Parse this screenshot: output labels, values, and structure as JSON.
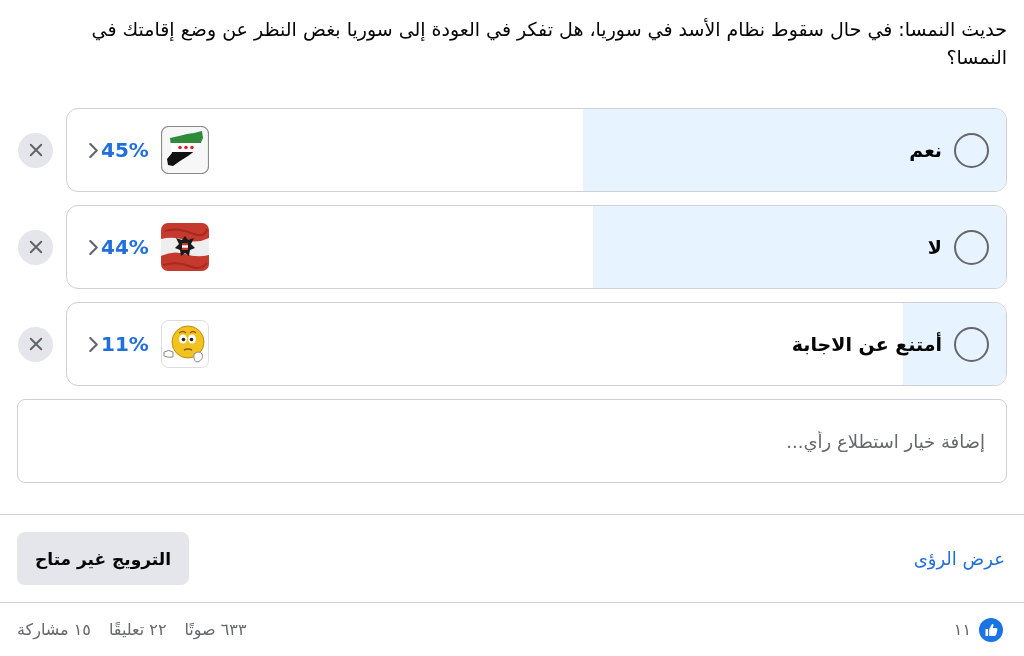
{
  "question": "حديث النمسا: في حال سقوط نظام الأسد في سوريا، هل تفكر في العودة إلى سوريا بغض النظر عن وضع إقامتك في النمسا؟",
  "options": [
    {
      "label": "نعم",
      "selected": false,
      "level": 0.45,
      "percent": "45%"
    },
    {
      "label": "لا",
      "selected": false,
      "level": 0.44,
      "percent": "44%"
    },
    {
      "label": "أمتنع عن الاجابة",
      "selected": false,
      "level": 0.11,
      "percent": "11%"
    }
  ],
  "add_option": {
    "placeholder": "إضافة خيار استطلاع رأي..."
  },
  "actions": {
    "insights_link": "عرض الرؤى",
    "boost_button": "الترويج غير متاح"
  },
  "footer": {
    "reactions": "١١",
    "votes": "٦٣٣ صوتًا",
    "comments": "٢٢ تعليقًا",
    "shares": "١٥ مشاركة"
  }
}
